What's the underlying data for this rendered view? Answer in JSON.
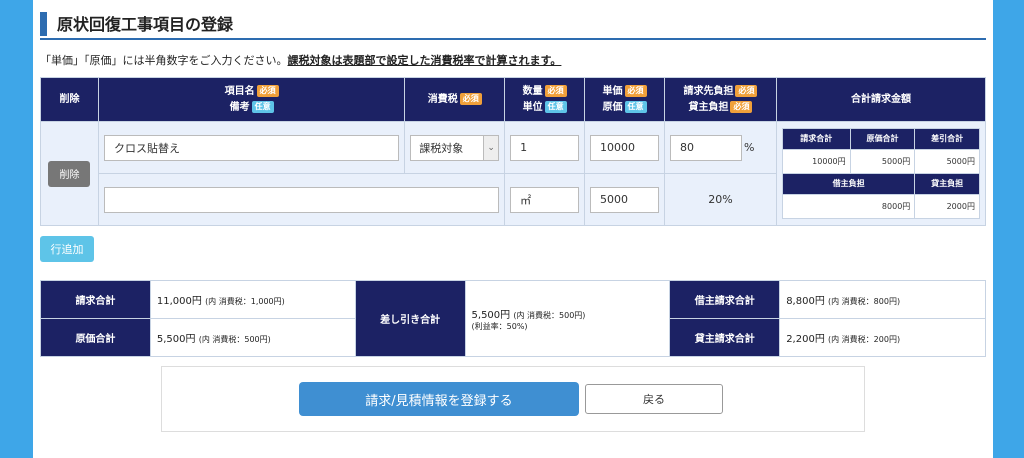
{
  "page": {
    "title": "原状回復工事項目の登録"
  },
  "notice": {
    "normal": "「単価」「原価」には半角数字をご入力ください。",
    "emphasis": "課税対象は表題部で設定した消費税率で計算されます。"
  },
  "badges": {
    "required": "必須",
    "optional": "任意"
  },
  "headers": {
    "delete": "削除",
    "item_name": "項目名",
    "remarks": "備考",
    "tax": "消費税",
    "quantity": "数量",
    "unit": "単位",
    "unit_price": "単価",
    "cost": "原価",
    "billing_share": "請求先負担",
    "landlord_share": "貸主負担",
    "total": "合計請求金額"
  },
  "row": {
    "delete_label": "削除",
    "item_name": "クロス貼替え",
    "remarks": "",
    "tax_option": "課税対象",
    "quantity": "1",
    "unit": "㎡",
    "unit_price": "10000",
    "cost": "5000",
    "billing_share": "80",
    "percent_symbol": "%",
    "landlord_share": "20%",
    "summary": {
      "h_billing_total": "請求合計",
      "h_cost_total": "原価合計",
      "h_diff_total": "差引合計",
      "billing_total": "10000円",
      "cost_total": "5000円",
      "diff_total": "5000円",
      "h_tenant": "借主負担",
      "h_landlord": "貸主負担",
      "tenant": "8000円",
      "landlord": "2000円"
    }
  },
  "add_row_label": "行追加",
  "totals": {
    "billing_label": "請求合計",
    "billing_value": "11,000円",
    "billing_tax": "(内 消費税：1,000円)",
    "cost_label": "原価合計",
    "cost_value": "5,500円",
    "cost_tax": "(内 消費税：500円)",
    "diff_label": "差し引き合計",
    "diff_value": "5,500円",
    "diff_tax": "(内 消費税：500円)",
    "diff_margin": "(利益率：50%)",
    "tenant_label": "借主請求合計",
    "tenant_value": "8,800円",
    "tenant_tax": "(内 消費税：800円)",
    "landlord_label": "貸主請求合計",
    "landlord_value": "2,200円",
    "landlord_tax": "(内 消費税：200円)"
  },
  "buttons": {
    "submit": "請求/見積情報を登録する",
    "back": "戻る"
  }
}
